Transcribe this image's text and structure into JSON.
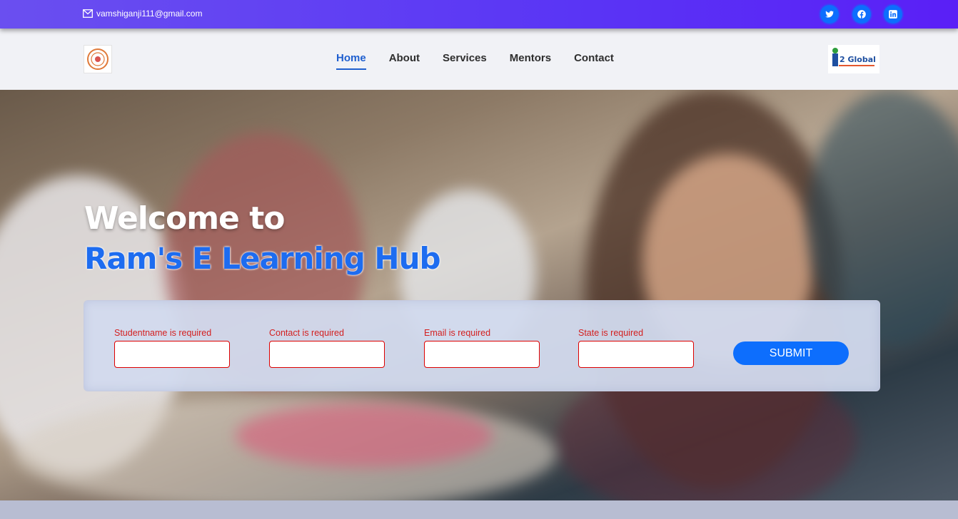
{
  "topbar": {
    "email": "vamshiganji111@gmail.com",
    "icons": [
      "mail-icon",
      "twitter-icon",
      "facebook-icon",
      "linkedin-icon"
    ],
    "accent": "#5a35f5"
  },
  "navbar": {
    "links": [
      "Home",
      "About",
      "Services",
      "Mentors",
      "Contact"
    ],
    "active": "Home",
    "right_logo_text": "2 Global"
  },
  "hero": {
    "line1": "Welcome to",
    "line2": "Ram's E Learning Hub"
  },
  "form": {
    "fields": [
      {
        "error": "Studentname is required",
        "value": ""
      },
      {
        "error": "Contact is required",
        "value": ""
      },
      {
        "error": "Email is required",
        "value": ""
      },
      {
        "error": "State is required",
        "value": ""
      }
    ],
    "submit_label": "SUBMIT"
  },
  "colors": {
    "primary": "#0d6efd",
    "error": "#d32020",
    "hero_blue": "#1d6cf0"
  }
}
